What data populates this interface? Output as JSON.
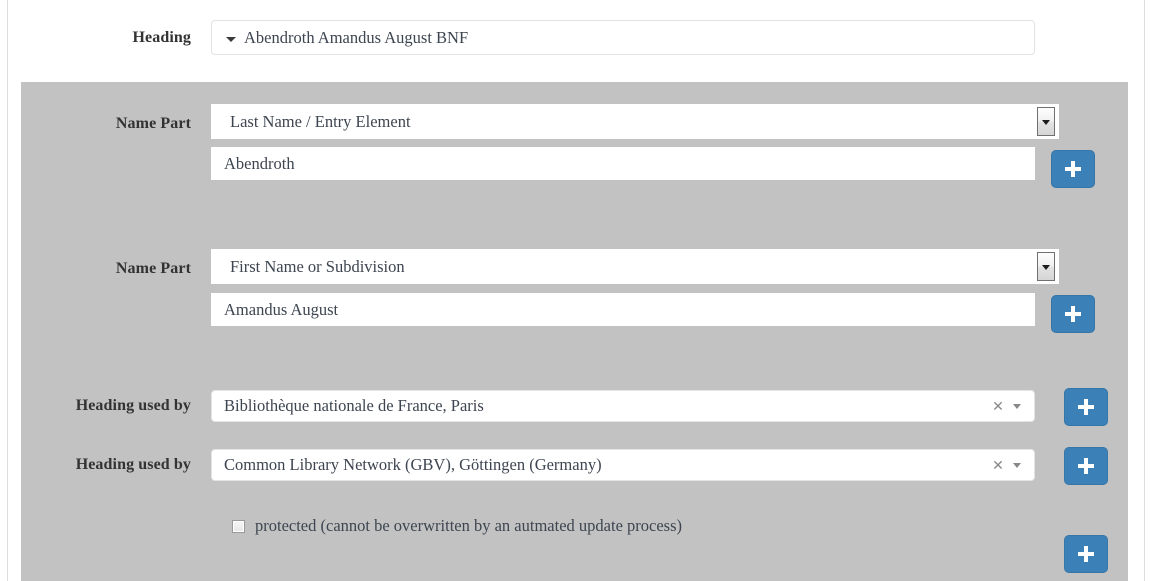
{
  "colors": {
    "panel_bg": "#c2c2c2",
    "page_bg": "#ffffff",
    "accent_blue": "#3c80b8",
    "text": "#3d4550",
    "label": "#333333"
  },
  "heading_row": {
    "label": "Heading",
    "value": "Abendroth Amandus August BNF",
    "caret_icon": "chevron-down-icon"
  },
  "name_parts": [
    {
      "label": "Name Part",
      "type_value": "Last Name / Entry Element",
      "name_value": "Abendroth",
      "dropdown_icon": "chevron-down-icon",
      "add_label": "+"
    },
    {
      "label": "Name Part",
      "type_value": "First Name or Subdivision",
      "name_value": "Amandus August",
      "dropdown_icon": "chevron-down-icon",
      "add_label": "+"
    }
  ],
  "heading_used_by": [
    {
      "label": "Heading used by",
      "value": "Bibliothèque nationale de France, Paris",
      "clear_icon": "close-icon",
      "clear_glyph": "✕",
      "arrow_icon": "chevron-down-icon",
      "add_label": "+"
    },
    {
      "label": "Heading used by",
      "value": "Common Library Network (GBV), Göttingen (Germany)",
      "clear_icon": "close-icon",
      "clear_glyph": "✕",
      "arrow_icon": "chevron-down-icon",
      "add_label": "+"
    }
  ],
  "protected": {
    "label": "protected (cannot be overwritten by an autmated update process)",
    "checked": false
  },
  "bottom_add": {
    "label": "+"
  }
}
